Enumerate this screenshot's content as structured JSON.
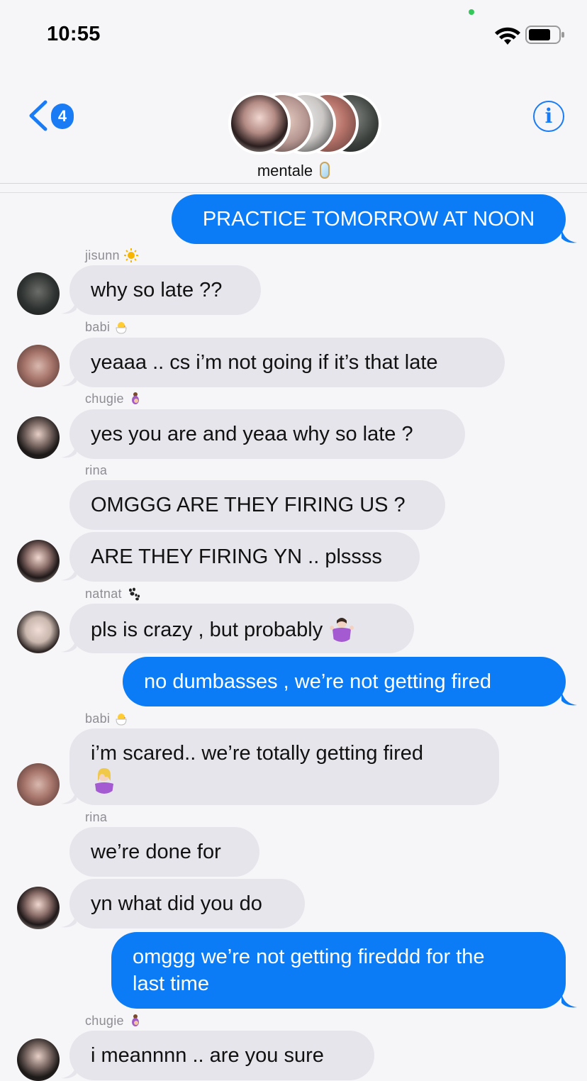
{
  "status_bar": {
    "time": "10:55"
  },
  "header": {
    "back_badge_count": "4",
    "group_name": "mentale",
    "info_label": "i"
  },
  "messages": [
    {
      "type": "out",
      "text": "PRACTICE TOMORROW AT NOON"
    },
    {
      "type": "in",
      "sender": "jisunn",
      "sender_emoji": "sun-icon",
      "text": "why so late ??"
    },
    {
      "type": "in",
      "sender": "babi",
      "sender_emoji": "hatching-chick-icon",
      "text": "yeaaa .. cs i’m not going if it’s that late"
    },
    {
      "type": "in",
      "sender": "chugie",
      "sender_emoji": "pregnant-person-icon",
      "text": "yes you are and yeaa why so late ?"
    },
    {
      "type": "in",
      "sender": "rina",
      "text": "OMGGG ARE THEY FIRING US ?"
    },
    {
      "type": "in",
      "text": "ARE THEY FIRING YN .. plssss"
    },
    {
      "type": "in",
      "sender": "natnat",
      "sender_emoji": "paw-prints-icon",
      "text": "pls is crazy , but probably",
      "trailing_emoji": "shrugging-person-icon"
    },
    {
      "type": "out",
      "text": "no dumbasses , we’re not getting fired"
    },
    {
      "type": "in",
      "sender": "babi",
      "sender_emoji": "hatching-chick-icon",
      "text": "i’m scared.. we’re totally getting fired",
      "trailing_emoji": "facepalm-icon"
    },
    {
      "type": "in",
      "sender": "rina",
      "text": "we’re done for"
    },
    {
      "type": "in",
      "text": "yn what did you do"
    },
    {
      "type": "out",
      "text": "omggg we’re not getting fireddd for the\nlast time"
    },
    {
      "type": "in",
      "sender": "chugie",
      "sender_emoji": "pregnant-person-icon",
      "text": "i meannnn .. are you sure"
    }
  ],
  "colors": {
    "outgoing_bubble": "#0b7cf5",
    "incoming_bubble": "#e6e5eb",
    "accent": "#1a7cf5",
    "background": "#f6f6f8"
  }
}
